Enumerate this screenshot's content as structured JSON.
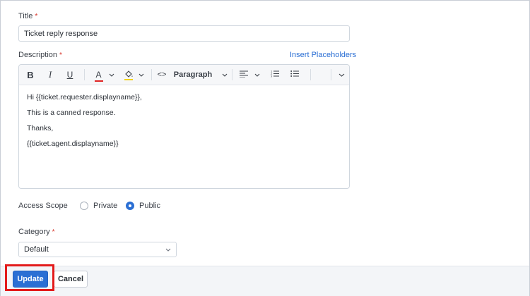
{
  "form": {
    "title_label": "Title",
    "required_mark": "*",
    "title_value": "Ticket reply response",
    "description_label": "Description",
    "insert_placeholders": "Insert Placeholders",
    "toolbar": {
      "bold": "B",
      "italic": "I",
      "underline": "U",
      "text_color": "A",
      "code": "<>",
      "paragraph": "Paragraph"
    },
    "body_lines": [
      "Hi {{ticket.requester.displayname}},",
      "This is a canned response.",
      "Thanks,",
      "{{ticket.agent.displayname}}"
    ],
    "access_scope_label": "Access Scope",
    "access_options": [
      {
        "label": "Private",
        "selected": false
      },
      {
        "label": "Public",
        "selected": true
      }
    ],
    "category_label": "Category",
    "category_value": "Default"
  },
  "footer": {
    "update_label": "Update",
    "cancel_label": "Cancel"
  },
  "colors": {
    "accent": "#2b6fd4",
    "required": "#d6342a",
    "highlight_box": "#e31b1b",
    "text_color_bar": "#e02424",
    "highlight_color_bar": "#f2d21b"
  }
}
